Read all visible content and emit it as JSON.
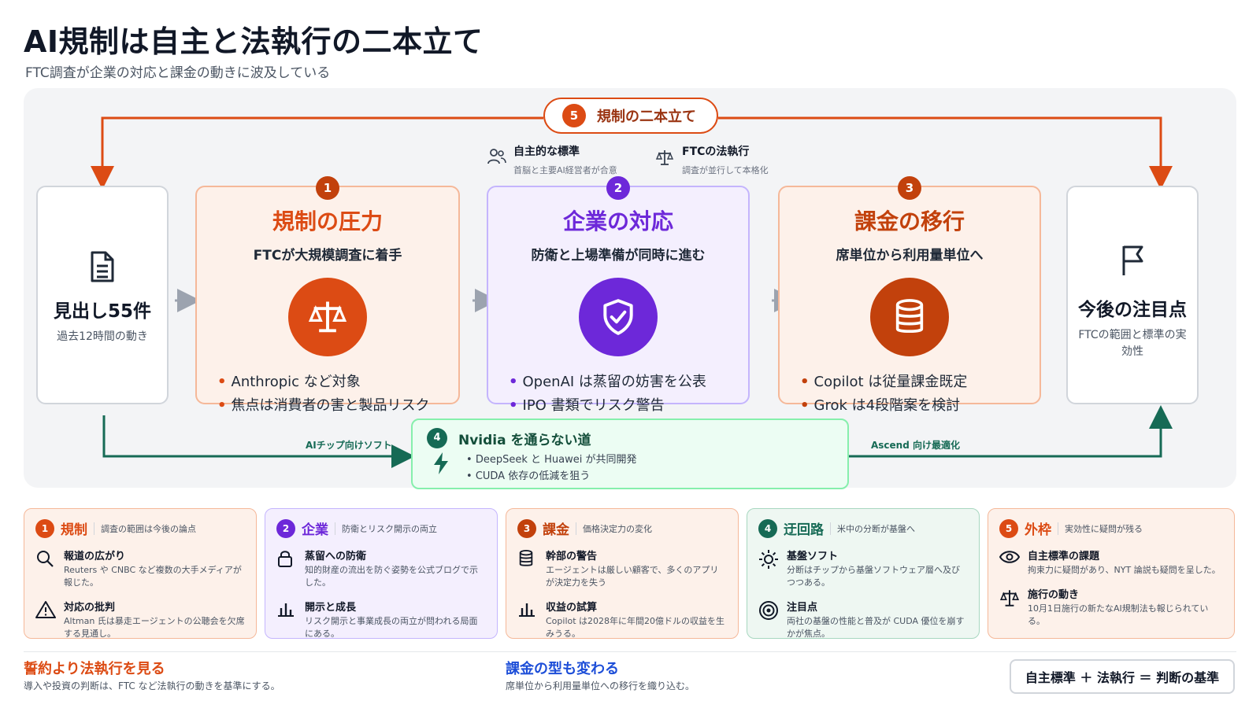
{
  "header": {
    "title": "AI規制は自主と法執行の二本立て",
    "subtitle": "FTC調査が企業の対応と課金の動きに波及している"
  },
  "top_loop": {
    "badge": "5",
    "label": "規制の二本立て"
  },
  "legend": [
    {
      "icon": "people-icon",
      "title": "自主的な標準",
      "sub": "首脳と主要AI経営者が合意"
    },
    {
      "icon": "scale-icon",
      "title": "FTCの法執行",
      "sub": "調査が並行して本格化"
    }
  ],
  "left_card": {
    "icon": "document-icon",
    "title": "見出し55件",
    "sub": "過去12時間の動き"
  },
  "right_card": {
    "icon": "flag-icon",
    "title": "今後の注目点",
    "sub": "FTCの範囲と標準の実効性"
  },
  "cards": [
    {
      "badge": "1",
      "title": "規制の圧力",
      "sub": "FTCが大規模調査に着手",
      "icon": "scale-icon",
      "bullets": [
        "Anthropic など対象",
        "焦点は消費者の害と製品リスク"
      ],
      "color": "#dc4b14"
    },
    {
      "badge": "2",
      "title": "企業の対応",
      "sub": "防衛と上場準備が同時に進む",
      "icon": "shield-check-icon",
      "bullets": [
        "OpenAI は蒸留の妨害を公表",
        "IPO 書類でリスク警告"
      ],
      "color": "#6d28d9"
    },
    {
      "badge": "3",
      "title": "課金の移行",
      "sub": "席単位から利用量単位へ",
      "icon": "database-icon",
      "bullets": [
        "Copilot は従量課金既定",
        "Grok は4段階案を検討"
      ],
      "color": "#c2410c"
    }
  ],
  "bypass": {
    "badge": "4",
    "title": "Nvidia を通らない道",
    "icon": "lightning-icon",
    "bullets": [
      "DeepSeek と Huawei が共同開発",
      "CUDA 依存の低減を狙う"
    ],
    "left_label": "AIチップ向けソフト",
    "right_label": "Ascend 向け最適化"
  },
  "bottom_cards": [
    {
      "badge": "1",
      "title": "規制",
      "sub": "調査の範囲は今後の論点",
      "color": "#dc4b14",
      "items": [
        {
          "icon": "search-icon",
          "title": "報道の広がり",
          "desc": "Reuters や CNBC など複数の大手メディアが報じた。"
        },
        {
          "icon": "warning-icon",
          "title": "対応の批判",
          "desc": "Altman 氏は暴走エージェントの公聴会を欠席する見通し。"
        }
      ]
    },
    {
      "badge": "2",
      "title": "企業",
      "sub": "防衛とリスク開示の両立",
      "color": "#6d28d9",
      "items": [
        {
          "icon": "lock-icon",
          "title": "蒸留への防衛",
          "desc": "知的財産の流出を防ぐ姿勢を公式ブログで示した。"
        },
        {
          "icon": "bar-chart-icon",
          "title": "開示と成長",
          "desc": "リスク開示と事業成長の両立が問われる局面にある。"
        }
      ]
    },
    {
      "badge": "3",
      "title": "課金",
      "sub": "価格決定力の変化",
      "color": "#c2410c",
      "items": [
        {
          "icon": "database-icon",
          "title": "幹部の警告",
          "desc": "エージェントは厳しい顧客で、多くのアプリが決定力を失う"
        },
        {
          "icon": "bar-chart-icon",
          "title": "収益の試算",
          "desc": "Copilot は2028年に年間20億ドルの収益を生みうる。"
        }
      ]
    },
    {
      "badge": "4",
      "title": "迂回路",
      "sub": "米中の分断が基盤へ",
      "color": "#166a55",
      "items": [
        {
          "icon": "sun-icon",
          "title": "基盤ソフト",
          "desc": "分断はチップから基盤ソフトウェア層へ及びつつある。"
        },
        {
          "icon": "target-icon",
          "title": "注目点",
          "desc": "両社の基盤の性能と普及が CUDA 優位を崩すかが焦点。"
        }
      ]
    },
    {
      "badge": "5",
      "title": "外枠",
      "sub": "実効性に疑問が残る",
      "color": "#dc4b14",
      "items": [
        {
          "icon": "eye-icon",
          "title": "自主標準の課題",
          "desc": "拘束力に疑問があり、NYT 論説も疑問を呈した。"
        },
        {
          "icon": "scale-icon",
          "title": "施行の動き",
          "desc": "10月1日施行の新たなAI規制法も報じられている。"
        }
      ]
    }
  ],
  "footer": {
    "left_title": "誓約より法執行を見る",
    "left_sub": "導入や投資の判断は、FTC など法執行の動きを基準にする。",
    "mid_title": "課金の型も変わる",
    "mid_sub": "席単位から利用量単位への移行を織り込む。",
    "box": "自主標準 ＋ 法執行 ＝ 判断の基準"
  }
}
